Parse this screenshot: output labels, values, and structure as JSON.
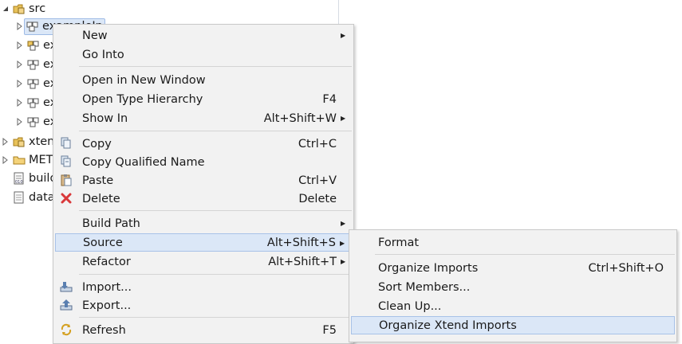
{
  "tree": {
    "items": [
      {
        "label": "src",
        "twisty": "expanded",
        "icon": "package-folder-icon"
      },
      {
        "label": "exampleIn",
        "twisty": "collapsed",
        "icon": "package-icon"
      },
      {
        "label": "ex",
        "twisty": "collapsed",
        "icon": "package-icon"
      },
      {
        "label": "ex",
        "twisty": "collapsed",
        "icon": "package-icon"
      },
      {
        "label": "ex",
        "twisty": "collapsed",
        "icon": "package-icon"
      },
      {
        "label": "ex",
        "twisty": "collapsed",
        "icon": "package-icon"
      },
      {
        "label": "ex",
        "twisty": "collapsed",
        "icon": "package-icon"
      },
      {
        "label": "xten",
        "twisty": "collapsed",
        "icon": "package-folder-icon"
      },
      {
        "label": "MET",
        "twisty": "collapsed",
        "icon": "folder-icon"
      },
      {
        "label": "build",
        "twisty": "none",
        "icon": "properties-file-icon"
      },
      {
        "label": "data",
        "twisty": "none",
        "icon": "text-file-icon"
      }
    ]
  },
  "context_menu": {
    "new": "New",
    "go_into": "Go Into",
    "open_new_window": "Open in New Window",
    "open_type_hierarchy": "Open Type Hierarchy",
    "open_type_hierarchy_key": "F4",
    "show_in": "Show In",
    "show_in_key": "Alt+Shift+W",
    "copy": "Copy",
    "copy_key": "Ctrl+C",
    "copy_qualified": "Copy Qualified Name",
    "paste": "Paste",
    "paste_key": "Ctrl+V",
    "delete": "Delete",
    "delete_key": "Delete",
    "build_path": "Build Path",
    "source": "Source",
    "source_key": "Alt+Shift+S",
    "refactor": "Refactor",
    "refactor_key": "Alt+Shift+T",
    "import": "Import...",
    "export": "Export...",
    "refresh": "Refresh",
    "refresh_key": "F5"
  },
  "source_submenu": {
    "format": "Format",
    "organize_imports": "Organize Imports",
    "organize_imports_key": "Ctrl+Shift+O",
    "sort_members": "Sort Members...",
    "clean_up": "Clean Up...",
    "organize_xtend_imports": "Organize Xtend Imports"
  },
  "colors": {
    "highlight": "#dbe7f7",
    "menu_bg": "#f2f2f2",
    "delete_red": "#d9383a"
  }
}
